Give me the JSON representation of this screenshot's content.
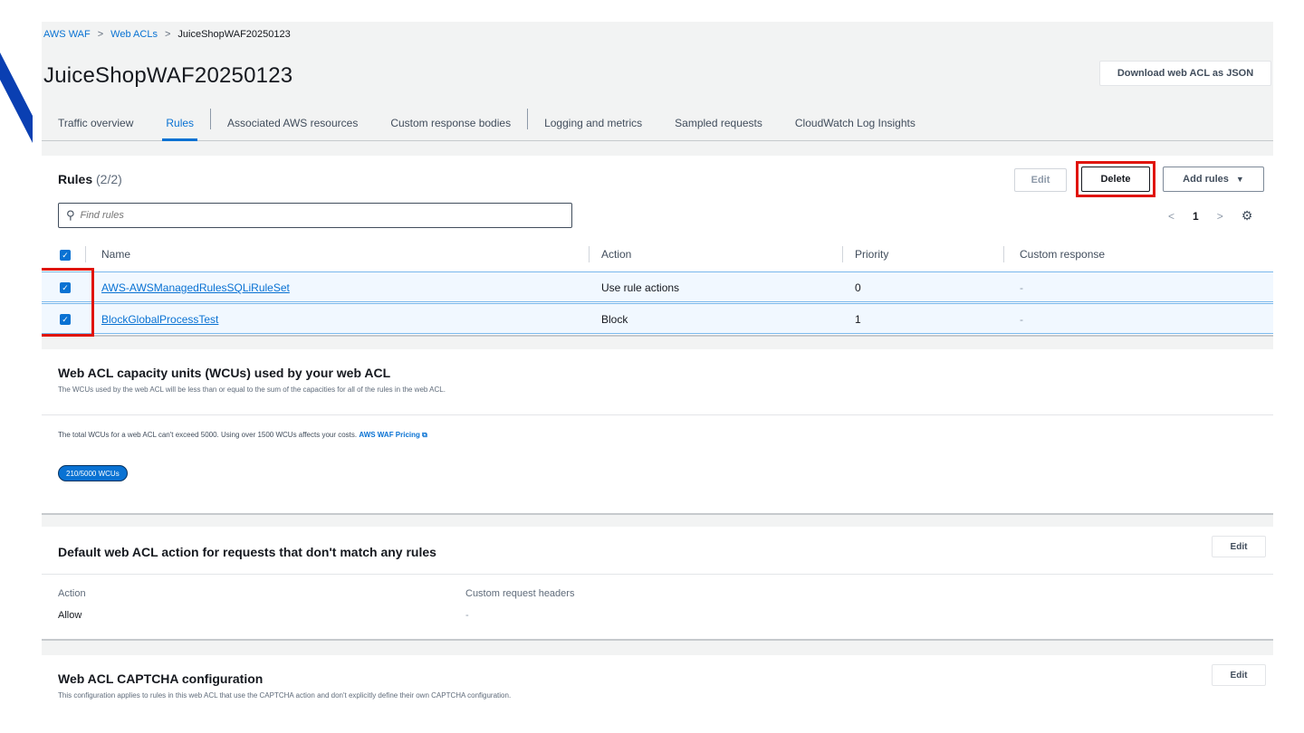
{
  "breadcrumb": {
    "items": [
      "AWS WAF",
      "Web ACLs",
      "JuiceShopWAF20250123"
    ],
    "separator": ">"
  },
  "page": {
    "title": "JuiceShopWAF20250123",
    "download_label": "Download web ACL as JSON"
  },
  "tabs": [
    {
      "label": "Traffic overview"
    },
    {
      "label": "Rules"
    },
    {
      "label": "Associated AWS resources"
    },
    {
      "label": "Custom response bodies"
    },
    {
      "label": "Logging and metrics"
    },
    {
      "label": "Sampled requests"
    },
    {
      "label": "CloudWatch Log Insights"
    }
  ],
  "rules": {
    "title": "Rules",
    "count": "(2/2)",
    "edit_label": "Edit",
    "delete_label": "Delete",
    "add_rules_label": "Add rules",
    "search_placeholder": "Find rules",
    "pager": {
      "prev": "<",
      "page": "1",
      "next": ">"
    },
    "columns": {
      "name": "Name",
      "action": "Action",
      "priority": "Priority",
      "custom_response": "Custom response"
    },
    "rows": [
      {
        "name": "AWS-AWSManagedRulesSQLiRuleSet",
        "action": "Use rule actions",
        "priority": "0",
        "custom_response": "-"
      },
      {
        "name": "BlockGlobalProcessTest",
        "action": "Block",
        "priority": "1",
        "custom_response": "-"
      }
    ]
  },
  "wcu": {
    "title": "Web ACL capacity units (WCUs) used by your web ACL",
    "description": "The WCUs used by the web ACL will be less than or equal to the sum of the capacities for all of the rules in the web ACL.",
    "note": "The total WCUs for a web ACL can't exceed 5000. Using over 1500 WCUs affects your costs.",
    "pricing_link": "AWS WAF Pricing",
    "badge": "210/5000 WCUs"
  },
  "default_action": {
    "title": "Default web ACL action for requests that don't match any rules",
    "edit_label": "Edit",
    "action_label": "Action",
    "action_value": "Allow",
    "headers_label": "Custom request headers",
    "headers_value": "-"
  },
  "captcha": {
    "title": "Web ACL CAPTCHA configuration",
    "description": "This configuration applies to rules in this web ACL that use the CAPTCHA action and don't explicitly define their own CAPTCHA configuration.",
    "edit_label": "Edit"
  },
  "colors": {
    "link": "#0972d3",
    "highlight": "#e0140b",
    "corner": "#0a3fb2"
  },
  "icons": {
    "search": "search-icon",
    "settings": "gear-icon",
    "external": "external-link-icon",
    "caret": "caret-down-icon"
  }
}
